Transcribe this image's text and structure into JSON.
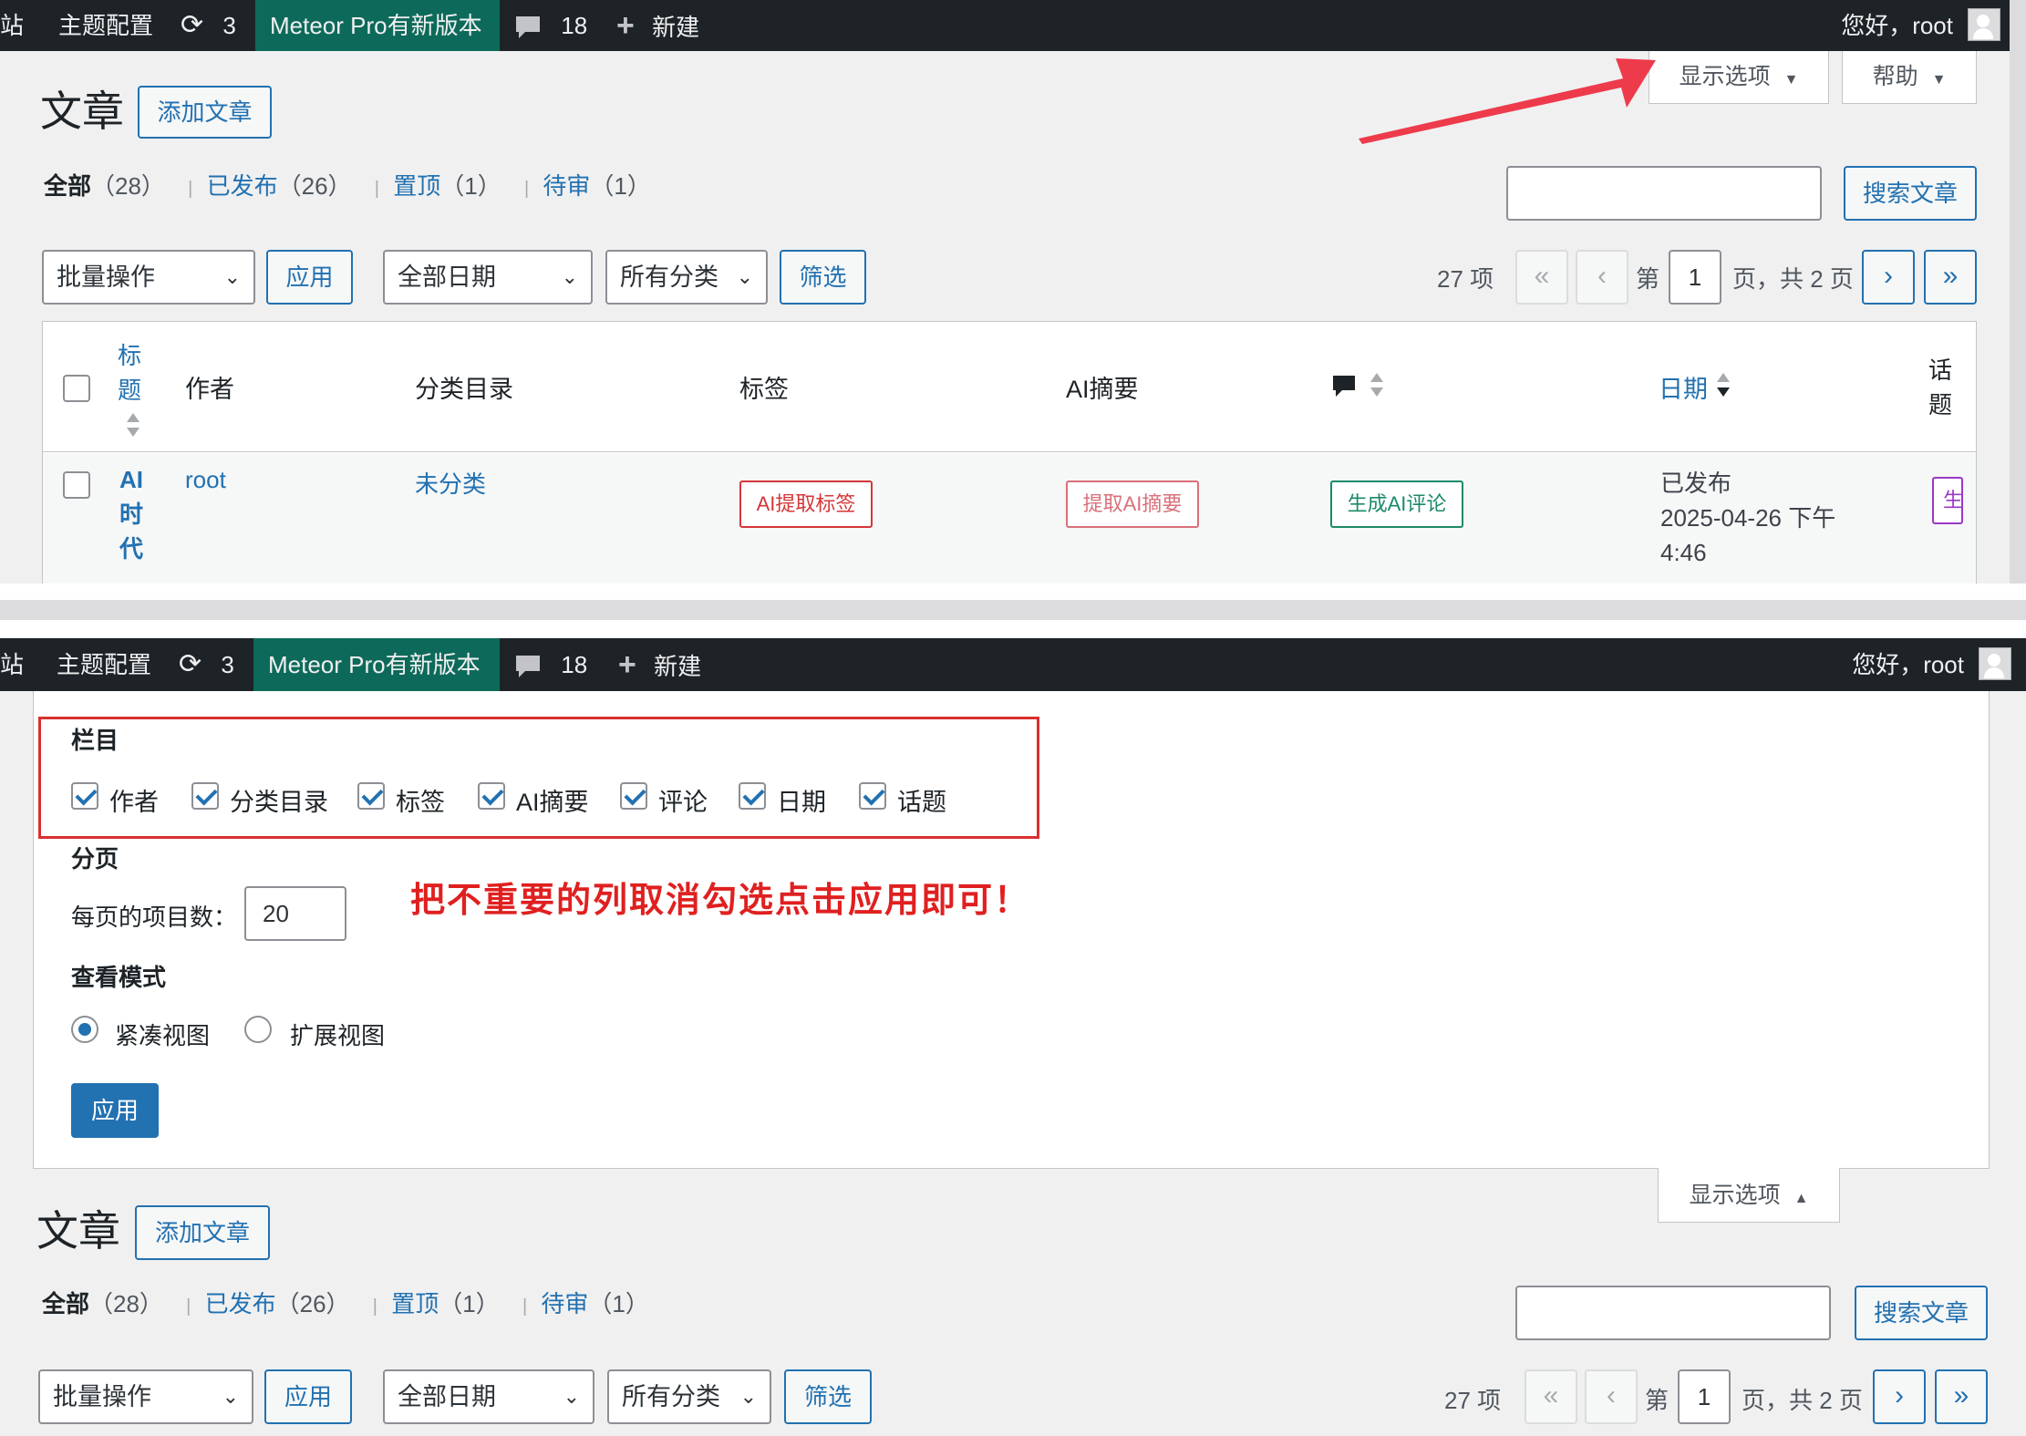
{
  "admin_bar": {
    "site_fragment": "站",
    "theme_config": "主题配置",
    "updates_count": "3",
    "theme_update": "Meteor Pro有新版本",
    "comments_count": "18",
    "new_label": "新建",
    "greeting": "您好，root"
  },
  "tabs": {
    "screen_options_label": "显示选项",
    "help_label": "帮助"
  },
  "page": {
    "title": "文章",
    "add_new": "添加文章"
  },
  "status_filters": {
    "all": "全部",
    "all_count": "（28）",
    "published": "已发布",
    "published_count": "（26）",
    "sticky": "置顶",
    "sticky_count": "（1）",
    "pending": "待审",
    "pending_count": "（1）",
    "separator": "|"
  },
  "search": {
    "value": "",
    "button_label": "搜索文章"
  },
  "tablenav": {
    "bulk_actions": "批量操作",
    "apply_label": "应用",
    "all_dates": "全部日期",
    "all_categories": "所有分类",
    "filter_label": "筛选",
    "items_count": "27 项",
    "first_page": "«",
    "prev_page": "‹",
    "page_prefix": "第",
    "current_page": "1",
    "page_suffix": "页，共 2 页",
    "next_page": "›",
    "last_page": "»"
  },
  "table": {
    "headers": {
      "title": "标题",
      "author": "作者",
      "categories": "分类目录",
      "tags": "标签",
      "ai_summary": "AI摘要",
      "date": "日期",
      "topic": "话题"
    },
    "row": {
      "title": "AI时代",
      "author": "root",
      "category": "未分类",
      "tag_button": "AI提取标签",
      "summary_button": "提取AI摘要",
      "comment_button": "生成AI评论",
      "status": "已发布",
      "date": "2025-04-26 下午",
      "time": "4:46",
      "topic_button_fragment": "生"
    }
  },
  "screen_options": {
    "columns_heading": "栏目",
    "columns": [
      {
        "label": "作者",
        "checked": true
      },
      {
        "label": "分类目录",
        "checked": true
      },
      {
        "label": "标签",
        "checked": true
      },
      {
        "label": "AI摘要",
        "checked": true
      },
      {
        "label": "评论",
        "checked": true
      },
      {
        "label": "日期",
        "checked": true
      },
      {
        "label": "话题",
        "checked": true
      }
    ],
    "pagination_heading": "分页",
    "per_page_label": "每页的项目数：",
    "per_page_value": "20",
    "view_mode_heading": "查看模式",
    "view_compact": "紧凑视图",
    "view_extended": "扩展视图",
    "apply_label": "应用"
  },
  "annotation": {
    "text": "把不重要的列取消勾选点击应用即可！",
    "color": "#e02020"
  },
  "colors": {
    "admin_bar_bg": "#1d2327",
    "accent": "#2271b1",
    "highlight_green": "#0d6a5a",
    "annotation_red": "#e02020"
  }
}
